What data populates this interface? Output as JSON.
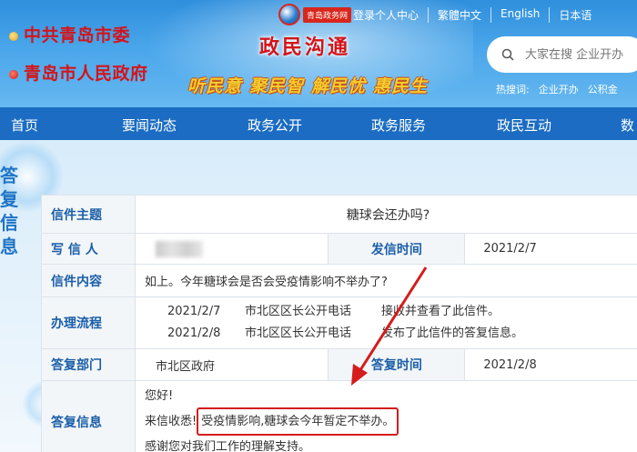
{
  "header": {
    "org_party": "中共青岛市委",
    "org_gov": "青岛市人民政府",
    "logo_text": "青岛政务网",
    "site_title": "政民沟通",
    "slogan": [
      "听民意",
      "聚民智",
      "解民忧",
      "惠民生"
    ],
    "top_links": [
      "登录个人中心",
      "繁體中文",
      "English",
      "日本语"
    ],
    "search_placeholder": "大家在搜 企业开办",
    "hot_label": "热搜词:",
    "hot_words": [
      "企业开办",
      "公积金"
    ]
  },
  "nav": {
    "items": [
      "首页",
      "要闻动态",
      "政务公开",
      "政务服务",
      "政民互动",
      "数"
    ]
  },
  "side_label": [
    "答",
    "复",
    "信",
    "息"
  ],
  "letter": {
    "subject_label": "信件主题",
    "subject": "糖球会还办吗?",
    "writer_label": "写 信 人",
    "send_time_label": "发信时间",
    "send_time": "2021/2/7",
    "content_label": "信件内容",
    "content": "如上。今年糖球会是否会受疫情影响不举办了?",
    "process_label": "办理流程",
    "process": [
      {
        "date": "2021/2/7",
        "unit": "市北区区长公开电话",
        "action": "接收并查看了此信件。"
      },
      {
        "date": "2021/2/8",
        "unit": "市北区区长公开电话",
        "action": "发布了此信件的答复信息。"
      }
    ],
    "reply_dept_label": "答复部门",
    "reply_dept": "市北区政府",
    "reply_time_label": "答复时间",
    "reply_time": "2021/2/8",
    "reply_label": "答复信息",
    "reply_greeting": "您好!",
    "reply_prefix": "来信收悉!",
    "reply_highlight": "受疫情影响,糖球会今年暂定不举办。",
    "reply_thanks": "感谢您对我们工作的理解支持。"
  },
  "colors": {
    "header_blue": "#2f8fdc",
    "nav_blue": "#1b6cc2",
    "brand_red": "#d4141a",
    "annotation_red": "#d41c1c"
  }
}
